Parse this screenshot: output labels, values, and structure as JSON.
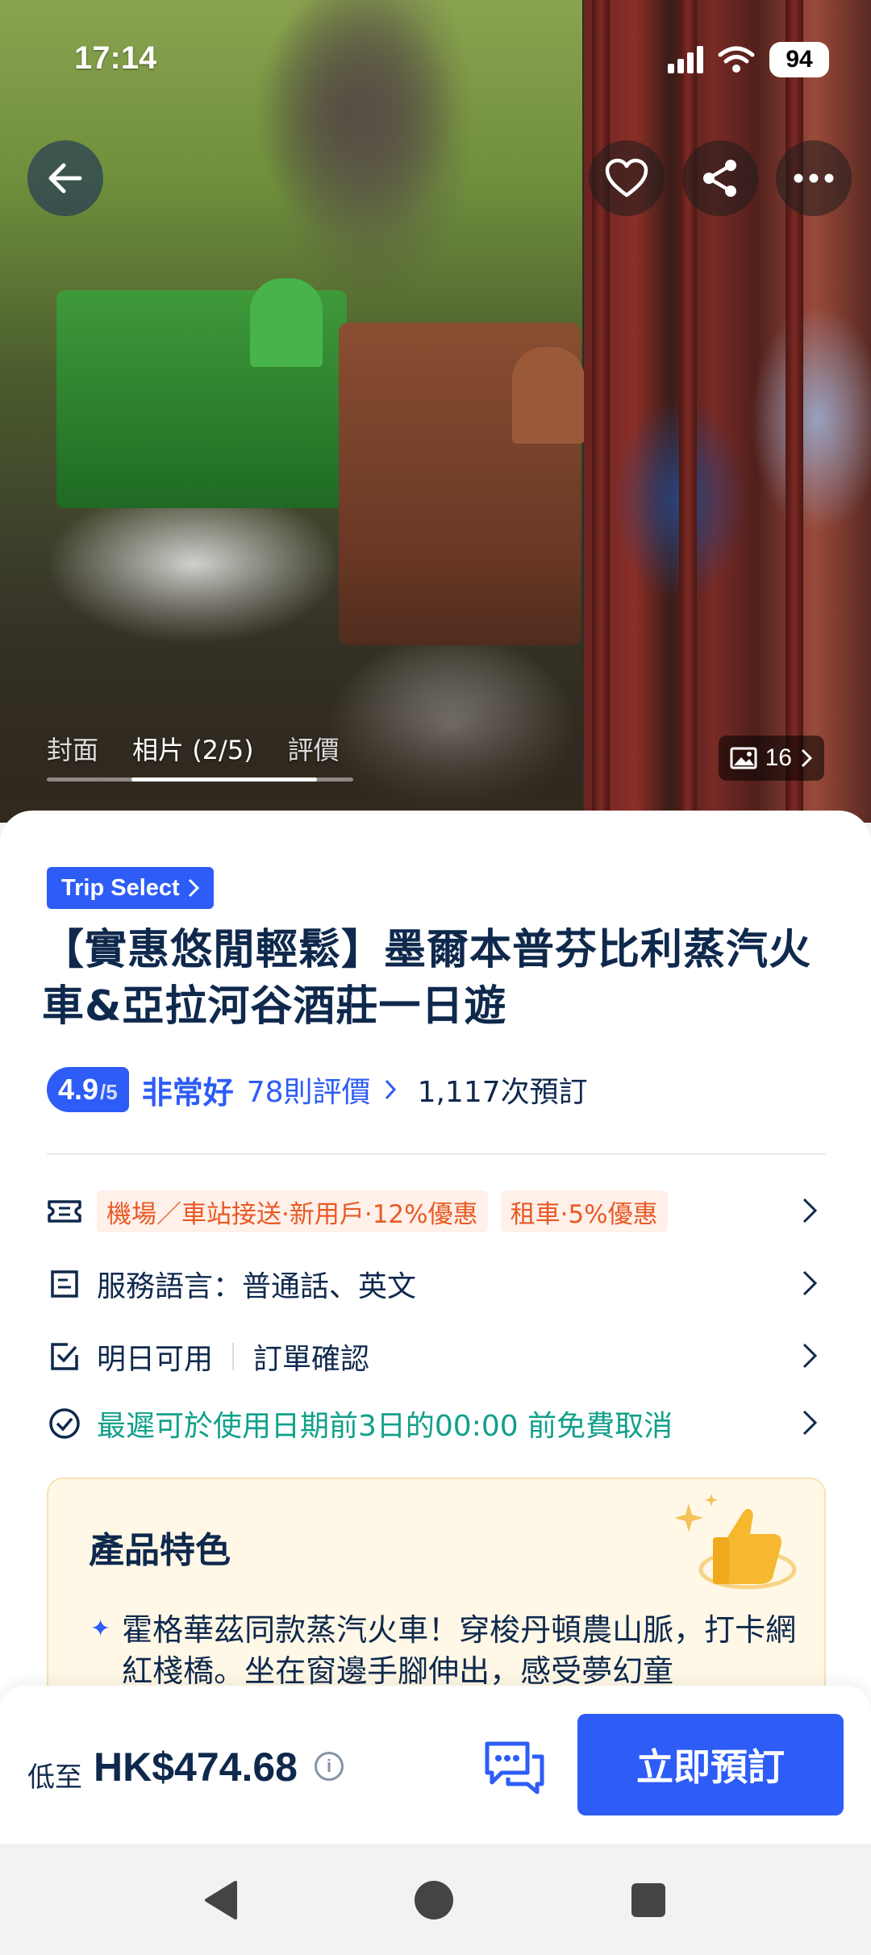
{
  "status": {
    "time": "17:14",
    "battery": "94"
  },
  "hero": {
    "tabs": [
      "封面",
      "相片 (2/5)",
      "評價"
    ],
    "active_tab": 1,
    "photo_count": "16"
  },
  "product": {
    "badge": "Trip Select",
    "title": "【實惠悠閒輕鬆】墨爾本普芬比利蒸汽火車&亞拉河谷酒莊一日遊",
    "rating": {
      "score": "4.9",
      "out_of": "/5",
      "label": "非常好",
      "reviews": "78則評價",
      "bookings": "1,117次預訂"
    }
  },
  "info": {
    "promo_tags": [
      "機場／車站接送·新用戶·12%優惠",
      "租車·5%優惠"
    ],
    "language": "服務語言：普通話、英文",
    "availability": "明日可用",
    "confirmation": "訂單確認",
    "cancellation": "最遲可於使用日期前3日的00:00 前免費取消"
  },
  "features": {
    "title": "產品特色",
    "item": "霍格華茲同款蒸汽火車！穿梭丹頓農山脈，打卡網紅棧橋。坐在窗邊手腳伸出，感受夢幻童"
  },
  "bottom": {
    "price_label": "低至",
    "price": "HK$474.68",
    "book_label": "立即預訂"
  },
  "colors": {
    "brand": "#2d5cf6",
    "title": "#0f294d",
    "promo": "#e85a24",
    "cancel": "#11a08a"
  }
}
